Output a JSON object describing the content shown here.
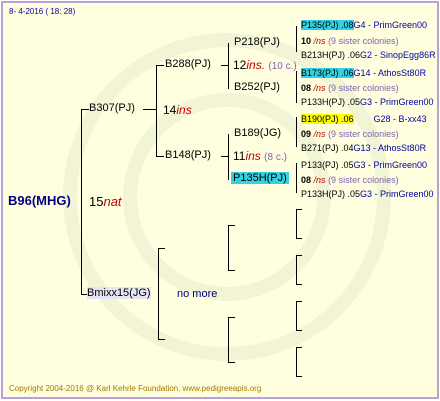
{
  "header": {
    "date": "8- 4-2016 ( 18: 28)"
  },
  "footer": {
    "copyright": "Copyright 2004-2016 @ Karl Kehrle Foundation.   www.pedigreeapis.org"
  },
  "root": {
    "name": "B96(MHG)",
    "num": "15",
    "tag": "nat"
  },
  "gen1": {
    "top": {
      "name": "B307(PJ)",
      "num": "14",
      "tag": "ins"
    },
    "bottom": {
      "name": "Bmixx15(JG)",
      "note": "no more"
    }
  },
  "gen2": {
    "a": {
      "name": "B288(PJ)",
      "num": "12",
      "tag": "ins.",
      "note": "(10 c.)"
    },
    "b": {
      "name": "B148(PJ)",
      "num": "11",
      "tag": "ins",
      "note": "(8 c.)"
    }
  },
  "gen3": {
    "a": {
      "name": "P218(PJ)",
      "num": "10",
      "tag": "/ns",
      "note": "(9 sister colonies)"
    },
    "b": {
      "name": "B252(PJ)",
      "num": "08",
      "tag": "/ns",
      "note": "(9 sister colonies)"
    },
    "c": {
      "name": "B189(JG)",
      "num": "09",
      "tag": "/ns",
      "note": "(9 sister colonies)"
    },
    "d": {
      "name": "P135H(PJ)",
      "num": "08",
      "tag": "/ns",
      "note": "(9 sister colonies)"
    }
  },
  "gen4": {
    "a1": {
      "name": "P135(PJ) .08",
      "line": "G4 - PrimGreen00"
    },
    "a2": {
      "name": "B213H(PJ) .06",
      "line": "G2 - SinopEgg86R"
    },
    "b1": {
      "name": "B173(PJ) .06",
      "line": "G14 - AthosSt80R"
    },
    "b2": {
      "name": "P133H(PJ) .05",
      "line": "G3 - PrimGreen00"
    },
    "c1": {
      "name": "B190(PJ) .06",
      "line": "G28 - B-xx43"
    },
    "c2": {
      "name": "B271(PJ) .04",
      "line": "G13 - AthosSt80R"
    },
    "d1": {
      "name": "P133(PJ) .05",
      "line": "G3 - PrimGreen00"
    },
    "d2": {
      "name": "P133H(PJ) .05",
      "line": "G3 - PrimGreen00"
    }
  }
}
